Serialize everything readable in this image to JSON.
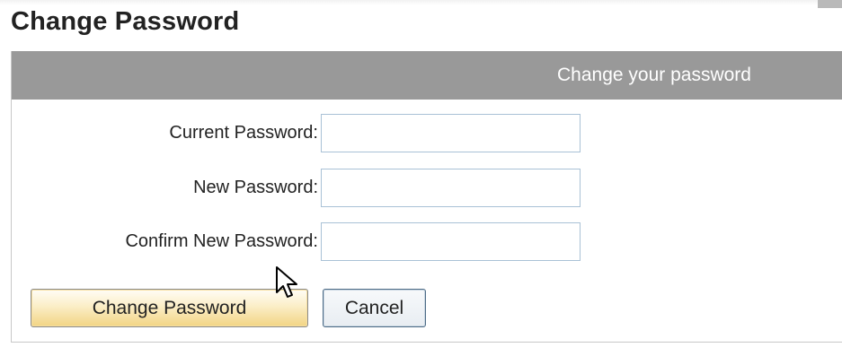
{
  "page": {
    "title": "Change Password"
  },
  "panel": {
    "header": "Change your password"
  },
  "form": {
    "current_password": {
      "label": "Current Password:",
      "value": ""
    },
    "new_password": {
      "label": "New Password:",
      "value": ""
    },
    "confirm_password": {
      "label": "Confirm New Password:",
      "value": ""
    }
  },
  "buttons": {
    "submit_label": "Change Password",
    "cancel_label": "Cancel"
  },
  "icons": {
    "cursor": "mouse-pointer-icon"
  },
  "colors": {
    "header_bar": "#999999",
    "primary_button": "#f2d483",
    "input_border": "#a9c1d6"
  }
}
